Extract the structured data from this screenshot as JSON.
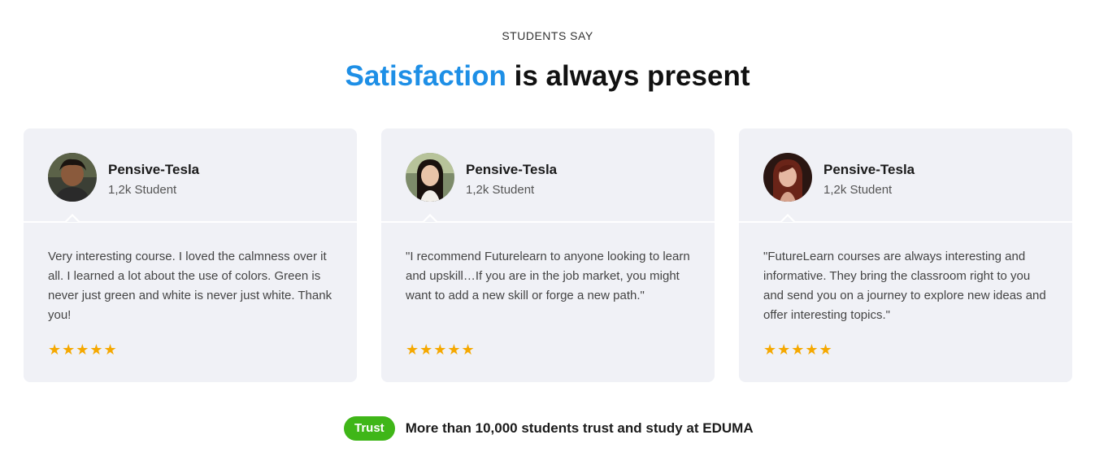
{
  "section": {
    "eyebrow": "STUDENTS SAY",
    "heading_accent": "Satisfaction",
    "heading_rest": " is always present"
  },
  "testimonials": [
    {
      "name": "Pensive-Tesla",
      "students": "1,2k Student",
      "quote": "Very interesting course. I loved the calmness over it all. I learned a lot about the use of colors. Green is never just green and white is never just white. Thank you!",
      "stars": "★★★★★",
      "rating": 5,
      "avatar": "avatar-photo"
    },
    {
      "name": "Pensive-Tesla",
      "students": "1,2k Student",
      "quote": "\"I recommend Futurelearn to anyone looking to learn and upskill…If you are in the job market, you might want to add a new skill or forge a new path.\"",
      "stars": "★★★★★",
      "rating": 5,
      "avatar": "avatar-photo"
    },
    {
      "name": "Pensive-Tesla",
      "students": "1,2k Student",
      "quote": "\"FutureLearn courses are always interesting and informative. They bring the classroom right to you and send you on a journey to explore new ideas and offer interesting topics.\"",
      "stars": "★★★★★",
      "rating": 5,
      "avatar": "avatar-photo"
    }
  ],
  "trust": {
    "badge": "Trust",
    "text": "More than 10,000 students trust and study at EDUMA"
  },
  "colors": {
    "accent": "#1e8fe6",
    "card_bg": "#f0f1f6",
    "star": "#f5a800",
    "badge": "#3fb618"
  }
}
